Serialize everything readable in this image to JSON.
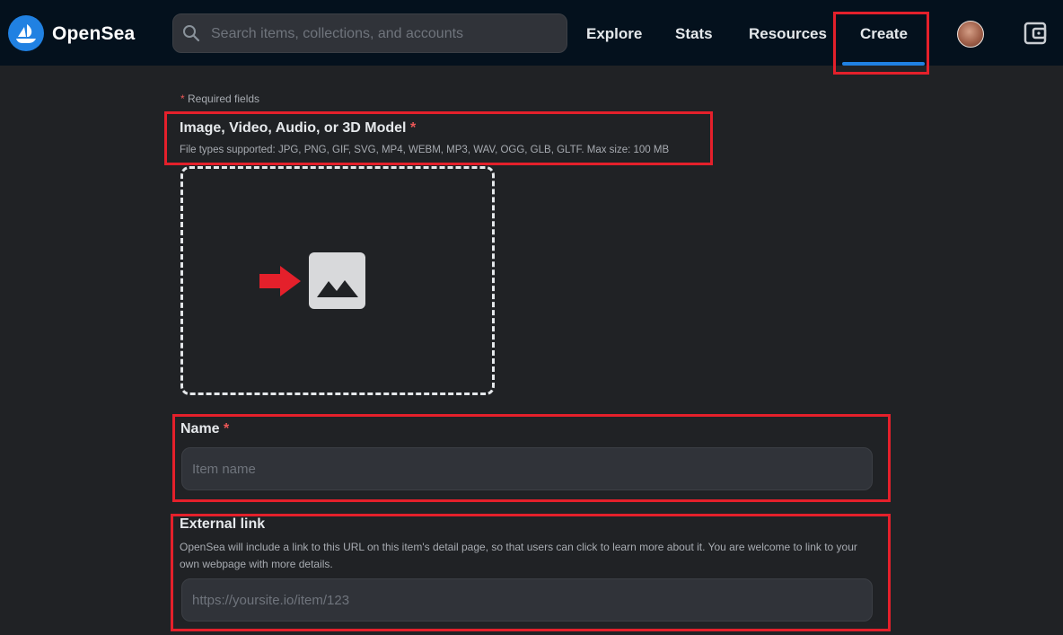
{
  "header": {
    "brand": "OpenSea",
    "search_placeholder": "Search items, collections, and accounts",
    "nav": {
      "explore": "Explore",
      "stats": "Stats",
      "resources": "Resources",
      "create": "Create"
    },
    "active_tab": "Create",
    "accent_color": "#2081e2"
  },
  "form": {
    "required_note": "Required fields",
    "required_star": "*",
    "media": {
      "label": "Image, Video, Audio, or 3D Model",
      "supported": "File types supported: JPG, PNG, GIF, SVG, MP4, WEBM, MP3, WAV, OGG, GLB, GLTF. Max size: 100 MB",
      "icon": "image-icon"
    },
    "name": {
      "label": "Name",
      "placeholder": "Item name",
      "value": ""
    },
    "external_link": {
      "label": "External link",
      "description": "OpenSea will include a link to this URL on this item's detail page, so that users can click to learn more about it. You are welcome to link to your own webpage with more details.",
      "placeholder": "https://yoursite.io/item/123",
      "value": ""
    }
  },
  "annotations": {
    "highlight_color": "#e4202b"
  }
}
